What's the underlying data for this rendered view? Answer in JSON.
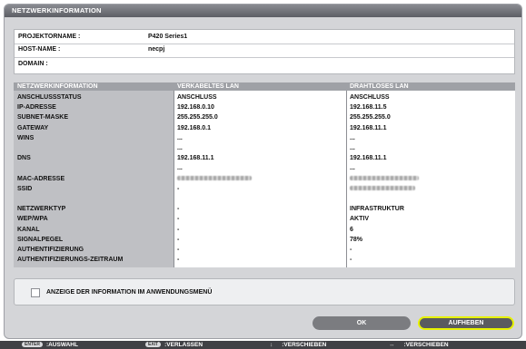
{
  "window": {
    "title": "NETZWERKINFORMATION"
  },
  "projector_info": [
    {
      "label": "PROJEKTORNAME :",
      "value": "P420 Series1"
    },
    {
      "label": "HOST-NAME :",
      "value": "necpj"
    },
    {
      "label": "DOMAIN :",
      "value": ""
    }
  ],
  "network_table": {
    "headers": [
      "NETZWERKINFORMATION",
      "VERKABELTES LAN",
      "DRAHTLOSES LAN"
    ],
    "rows": [
      {
        "label": "ANSCHLUSSSTATUS",
        "wired": "ANSCHLUSS",
        "wireless": "ANSCHLUSS"
      },
      {
        "label": "IP-ADRESSE",
        "wired": "192.168.0.10",
        "wireless": "192.168.11.5"
      },
      {
        "label": "SUBNET-MASKE",
        "wired": "255.255.255.0",
        "wireless": "255.255.255.0"
      },
      {
        "label": "GATEWAY",
        "wired": "192.168.0.1",
        "wireless": "192.168.11.1"
      },
      {
        "label": "WINS",
        "wired": "...",
        "wireless": "..."
      },
      {
        "label": "",
        "wired": "...",
        "wireless": "..."
      },
      {
        "label": "DNS",
        "wired": "192.168.11.1",
        "wireless": "192.168.11.1"
      },
      {
        "label": "",
        "wired": "...",
        "wireless": "..."
      },
      {
        "label": "MAC-ADRESSE",
        "wired": "",
        "wireless": ""
      },
      {
        "label": "SSID",
        "wired": "-",
        "wireless": ""
      },
      {
        "label": "",
        "wired": "",
        "wireless": ""
      },
      {
        "label": "NETZWERKTYP",
        "wired": "-",
        "wireless": "INFRASTRUKTUR"
      },
      {
        "label": "WEP/WPA",
        "wired": "-",
        "wireless": "AKTIV"
      },
      {
        "label": "KANAL",
        "wired": "-",
        "wireless": "6"
      },
      {
        "label": "SIGNALPEGEL",
        "wired": "-",
        "wireless": "78%"
      },
      {
        "label": "AUTHENTIFIZIERUNG",
        "wired": "-",
        "wireless": "-"
      },
      {
        "label": "AUTHENTIFIZIERUNGS-ZEITRAUM",
        "wired": "-",
        "wireless": "-"
      }
    ]
  },
  "checkbox": {
    "label": "ANZEIGE DER INFORMATION IM ANWENDUNGSMENÜ",
    "checked": false
  },
  "buttons": {
    "ok": "OK",
    "cancel": "AUFHEBEN"
  },
  "footer": [
    {
      "key": "ENTER",
      "label": ":AUSWAHL",
      "icon": "enter-key-icon"
    },
    {
      "key": "EXIT",
      "label": ":VERLASSEN",
      "icon": "exit-key-icon"
    },
    {
      "key": "↕",
      "label": ":VERSCHIEBEN",
      "icon": "up-down-arrow-icon"
    },
    {
      "key": "↔",
      "label": ":VERSCHIEBEN",
      "icon": "left-right-arrow-icon"
    }
  ],
  "colors": {
    "selected_button_border": "#e7f200",
    "title_bar": "#6f7177",
    "footer": "#404145"
  }
}
